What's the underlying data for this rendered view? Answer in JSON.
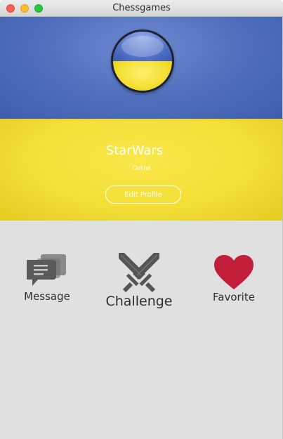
{
  "window": {
    "title": "Chessgames"
  },
  "profile": {
    "username": "StarWars",
    "status": "Online",
    "edit_label": "Edit Profile"
  },
  "actions": {
    "message_label": "Message",
    "challenge_label": "Challenge",
    "favorite_label": "Favorite"
  },
  "icons": {
    "message": "chat-bubbles-icon",
    "challenge": "crossed-swords-icon",
    "favorite": "heart-icon"
  },
  "colors": {
    "flag_blue": "#5272be",
    "flag_yellow": "#f3df36",
    "panel_bg": "#dfe0df",
    "heart": "#c21e3a",
    "icon_gray": "#5a5a5a"
  }
}
